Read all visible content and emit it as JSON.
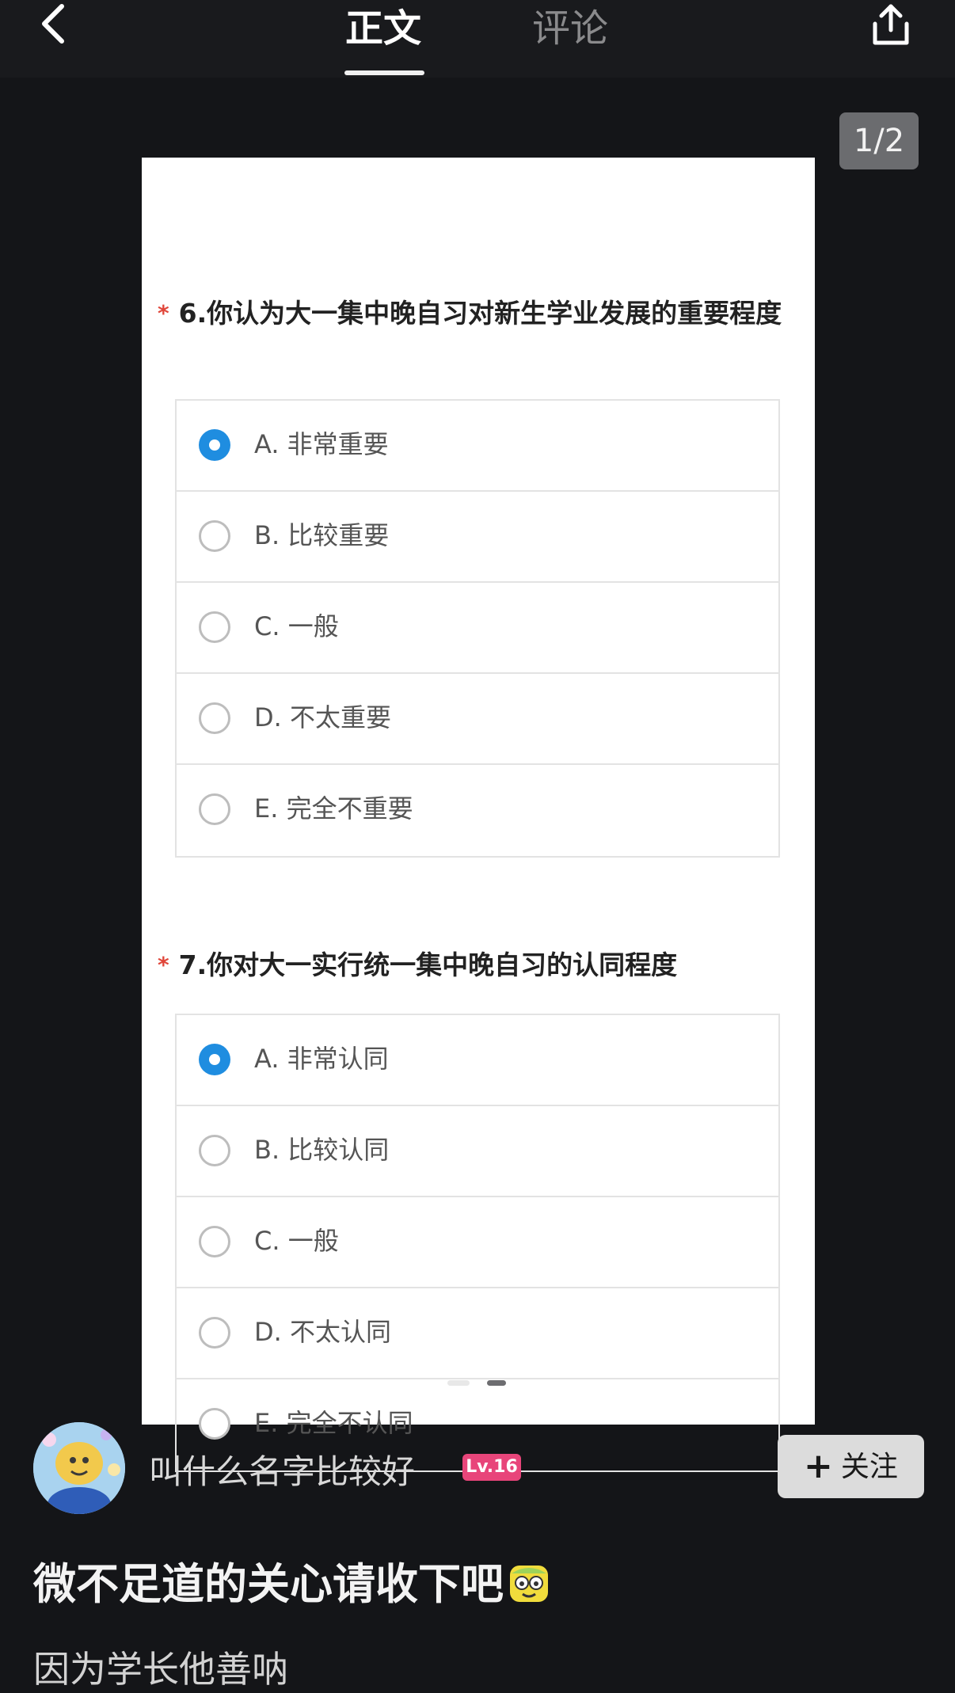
{
  "header": {
    "tabs": [
      {
        "label": "正文",
        "active": true
      },
      {
        "label": "评论",
        "active": false
      }
    ],
    "back_icon": "chevron-left-icon",
    "share_icon": "share-icon"
  },
  "viewer": {
    "page_counter": "1/2",
    "carousel": {
      "count": 2,
      "active_index": 0
    }
  },
  "survey": {
    "questions": [
      {
        "required_mark": "*",
        "text": "6.你认为大一集中晚自习对新生学业发展的重要程度",
        "options": [
          {
            "label": "A. 非常重要",
            "selected": true
          },
          {
            "label": "B. 比较重要",
            "selected": false
          },
          {
            "label": "C. 一般",
            "selected": false
          },
          {
            "label": "D. 不太重要",
            "selected": false
          },
          {
            "label": "E. 完全不重要",
            "selected": false
          }
        ]
      },
      {
        "required_mark": "*",
        "text": "7.你对大一实行统一集中晚自习的认同程度",
        "options": [
          {
            "label": "A. 非常认同",
            "selected": true
          },
          {
            "label": "B. 比较认同",
            "selected": false
          },
          {
            "label": "C. 一般",
            "selected": false
          },
          {
            "label": "D. 不太认同",
            "selected": false
          },
          {
            "label": "E. 完全不认同",
            "selected": false
          }
        ]
      }
    ]
  },
  "author": {
    "name": "叫什么名字比较好",
    "level": "Lv.16",
    "follow_label": "关注",
    "follow_icon": "plus-icon"
  },
  "post": {
    "title": "微不足道的关心请收下吧",
    "title_emoji": "smiling-face-emoji",
    "body": "因为学长他善呐"
  },
  "colors": {
    "background": "#141518",
    "accent_radio": "#1f8de0",
    "required_star": "#e0463a",
    "level_badge": "#e8457a"
  }
}
